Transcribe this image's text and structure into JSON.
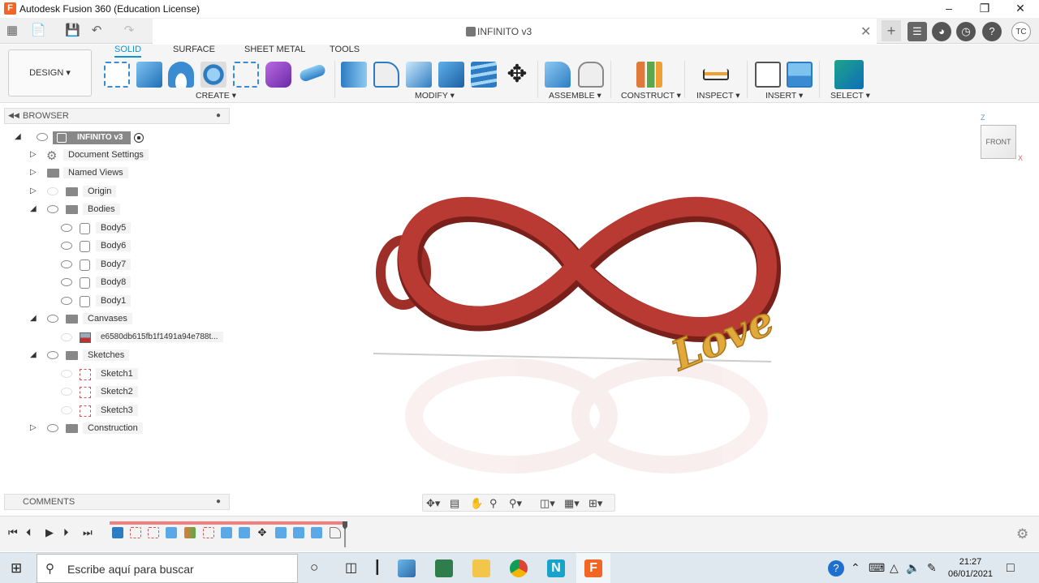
{
  "app": {
    "window_title": "Autodesk Fusion 360 (Education License)",
    "logo_letter": "F",
    "doc_tab": "INFINITO v3",
    "user_initials": "TC"
  },
  "toolbar": {
    "workspace": "DESIGN",
    "tabs": [
      "SOLID",
      "SURFACE",
      "SHEET METAL",
      "TOOLS"
    ],
    "groups": [
      "CREATE",
      "MODIFY",
      "ASSEMBLE",
      "CONSTRUCT",
      "INSPECT",
      "INSERT",
      "SELECT"
    ]
  },
  "browser": {
    "header": "BROWSER",
    "root": "INFINITO v3",
    "items": {
      "document_settings": "Document Settings",
      "named_views": "Named Views",
      "origin": "Origin",
      "bodies": "Bodies",
      "body5": "Body5",
      "body6": "Body6",
      "body7": "Body7",
      "body8": "Body8",
      "body1": "Body1",
      "canvases": "Canvases",
      "canvas1": "e6580db615fb1f1491a94e788t...",
      "sketches": "Sketches",
      "sketch1": "Sketch1",
      "sketch2": "Sketch2",
      "sketch3": "Sketch3",
      "construction": "Construction"
    }
  },
  "comments": {
    "header": "COMMENTS"
  },
  "viewcube": {
    "face": "FRONT",
    "axis_z": "Z",
    "axis_x": "X"
  },
  "model": {
    "text": "Love",
    "body_color": "#b83a32",
    "text_color": "#e0a93a"
  },
  "taskbar": {
    "search_placeholder": "Escribe aquí para buscar",
    "time": "21:27",
    "date": "06/01/2021"
  },
  "colors": {
    "accent": "#0696d7",
    "fusion_orange": "#f26522"
  }
}
